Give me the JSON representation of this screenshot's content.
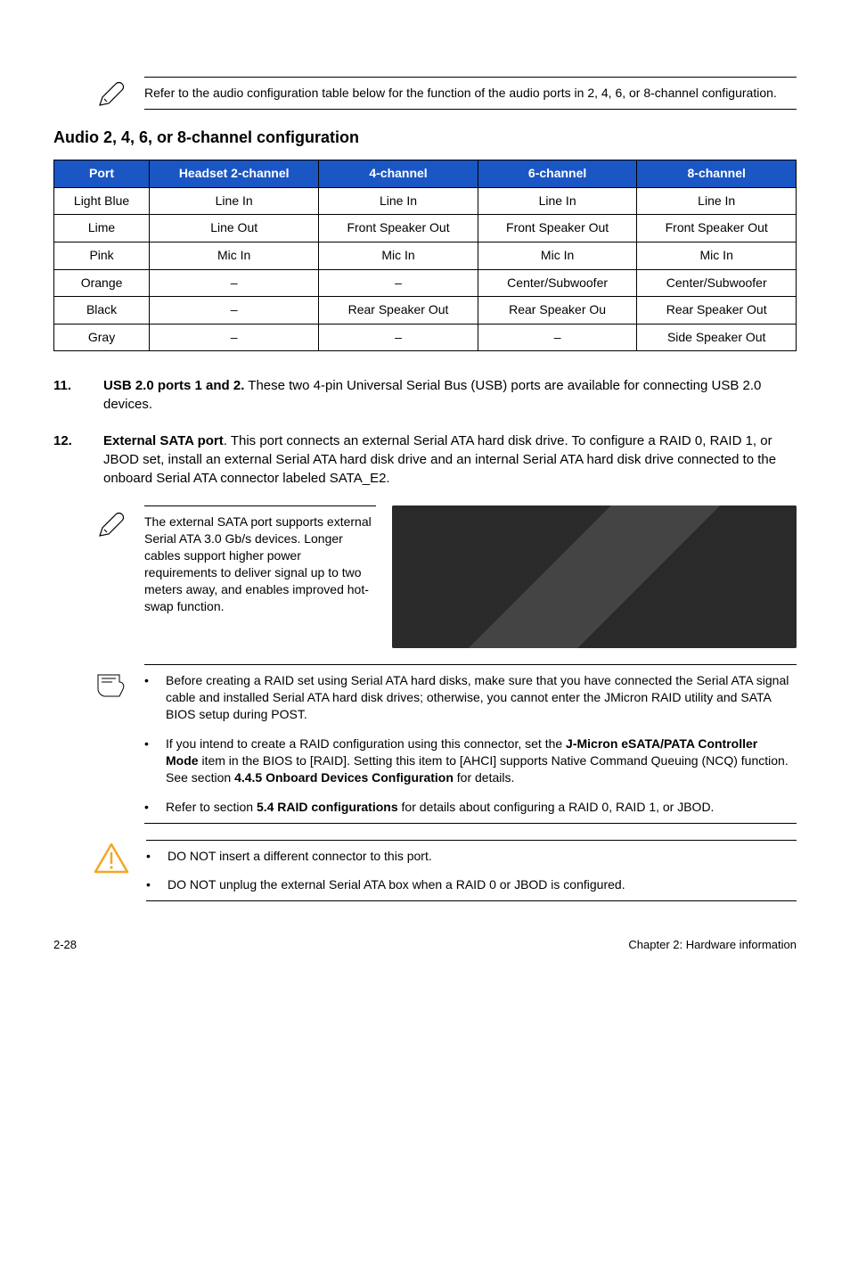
{
  "top_note": "Refer to the audio configuration table below for the function of the audio ports in 2, 4, 6, or 8-channel configuration.",
  "audio_heading": "Audio 2, 4, 6, or 8-channel configuration",
  "audio_table": {
    "headers": [
      "Port",
      "Headset 2-channel",
      "4-channel",
      "6-channel",
      "8-channel"
    ],
    "rows": [
      [
        "Light Blue",
        "Line In",
        "Line In",
        "Line In",
        "Line In"
      ],
      [
        "Lime",
        "Line Out",
        "Front Speaker Out",
        "Front Speaker Out",
        "Front Speaker Out"
      ],
      [
        "Pink",
        "Mic In",
        "Mic In",
        "Mic In",
        "Mic In"
      ],
      [
        "Orange",
        "–",
        "–",
        "Center/Subwoofer",
        "Center/Subwoofer"
      ],
      [
        "Black",
        "–",
        "Rear Speaker Out",
        "Rear Speaker Ou",
        "Rear Speaker Out"
      ],
      [
        "Gray",
        "–",
        "–",
        "–",
        "Side Speaker Out"
      ]
    ]
  },
  "item11": {
    "num": "11.",
    "bold": "USB 2.0 ports 1 and 2.",
    "rest": " These two 4-pin Universal Serial Bus (USB) ports are available for connecting USB 2.0 devices."
  },
  "item12": {
    "num": "12.",
    "bold": "External SATA port",
    "rest": ". This port connects an external Serial ATA hard disk drive. To configure a RAID 0, RAID 1, or JBOD set, install an external Serial ATA hard disk drive and an internal Serial ATA hard disk drive connected to the onboard Serial ATA connector labeled SATA_E2."
  },
  "sata_note": "The external SATA port supports external Serial ATA 3.0 Gb/s devices. Longer cables support higher power requirements to deliver signal up to two meters away, and enables improved hot-swap function.",
  "reminder_bullets": {
    "b1": "Before creating a RAID set using Serial ATA hard disks, make sure that you have connected the Serial ATA signal cable and installed Serial ATA hard disk drives; otherwise, you cannot enter the JMicron RAID utility and SATA BIOS setup during POST.",
    "b2_pre": "If you intend to create a RAID configuration using this connector, set the ",
    "b2_bold1": "J-Micron eSATA/PATA Controller Mode",
    "b2_mid": " item in the BIOS to [RAID]. Setting this item to [AHCI] supports Native Command Queuing (NCQ) function. See section ",
    "b2_bold2": "4.4.5 Onboard Devices Configuration",
    "b2_post": " for details.",
    "b3_pre": "Refer to section ",
    "b3_bold": "5.4 RAID configurations",
    "b3_post": " for details about configuring a RAID 0, RAID 1, or JBOD."
  },
  "warn_bullets": {
    "w1": "DO NOT insert a different connector to this port.",
    "w2": "DO NOT unplug the external Serial ATA box when a RAID 0 or JBOD is configured."
  },
  "footer": {
    "left": "2-28",
    "right": "Chapter 2: Hardware information"
  }
}
